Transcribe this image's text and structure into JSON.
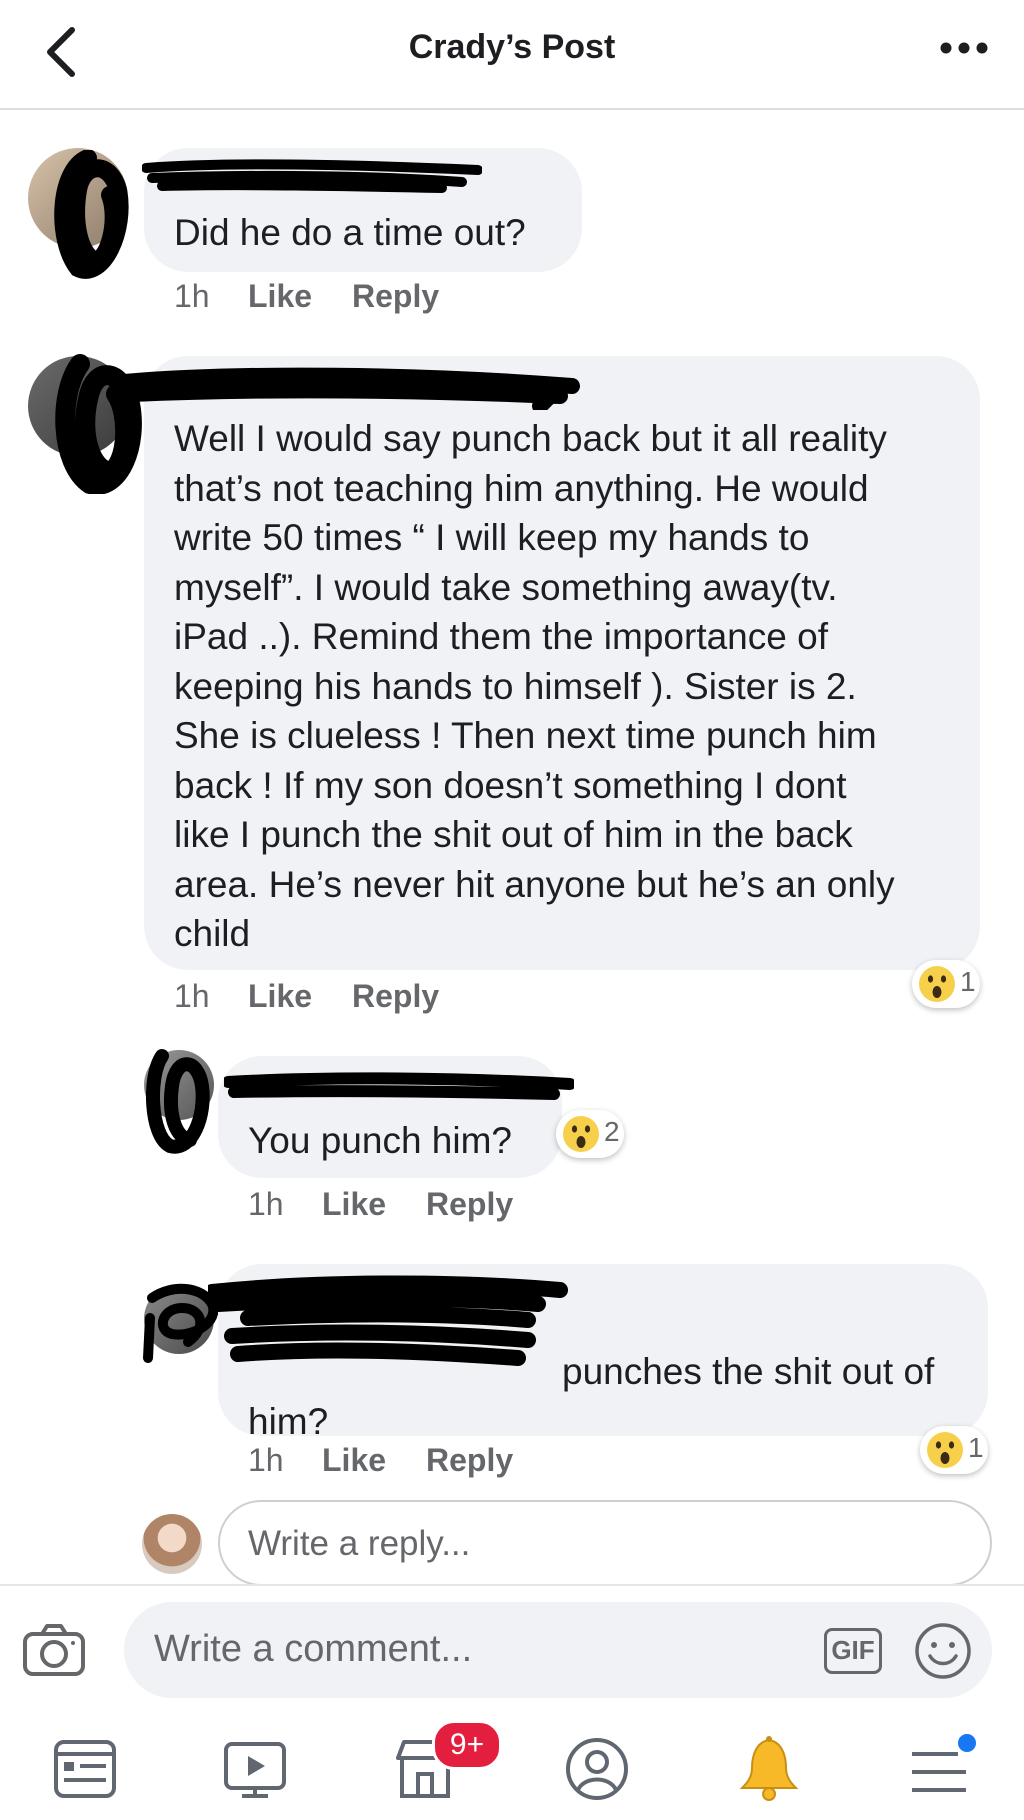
{
  "header": {
    "title": "Crady’s Post",
    "back_icon": "chevron-left-icon",
    "more_icon": "more-dots-icon"
  },
  "comments": [
    {
      "text": "Did he do a time out?",
      "time": "1h",
      "like": "Like",
      "reply": "Reply"
    },
    {
      "lines": [
        "Well I would say punch back but it all reality",
        "that’s not teaching him anything. He would",
        "write 50 times “ I will keep my hands to",
        "myself”. I would take something away(tv.",
        "iPad ..). Remind them the importance of",
        "keeping his hands to himself ). Sister is 2.",
        "She is clueless ! Then next time punch him",
        "back ! If my son doesn’t something I dont",
        "like I punch the shit out of him in the back",
        "area. He’s never hit anyone but he’s an only",
        "child"
      ],
      "time": "1h",
      "like": "Like",
      "reply": "Reply",
      "reaction": {
        "icon": "wow-emoji-icon",
        "count": "1"
      }
    }
  ],
  "replies": [
    {
      "text": "You punch him?",
      "time": "1h",
      "like": "Like",
      "reply": "Reply",
      "reaction": {
        "icon": "wow-emoji-icon",
        "count": "2"
      }
    },
    {
      "line1": "punches the shit out of",
      "line2": "him?",
      "time": "1h",
      "like": "Like",
      "reply": "Reply",
      "reaction": {
        "icon": "wow-emoji-icon",
        "count": "1"
      }
    }
  ],
  "reply_input": {
    "placeholder": "Write a reply..."
  },
  "composer": {
    "placeholder": "Write a comment...",
    "gif_label": "GIF"
  },
  "tabbar": {
    "items": [
      "news-feed-icon",
      "watch-video-icon",
      "marketplace-icon",
      "profile-icon",
      "notifications-bell-icon",
      "menu-icon"
    ],
    "marketplace_badge": "9+"
  },
  "colors": {
    "accent": "#1877f2",
    "badge": "#e41e3f",
    "bubble": "#f0f2f5",
    "meta": "#65676b",
    "bell": "#f7b928"
  }
}
